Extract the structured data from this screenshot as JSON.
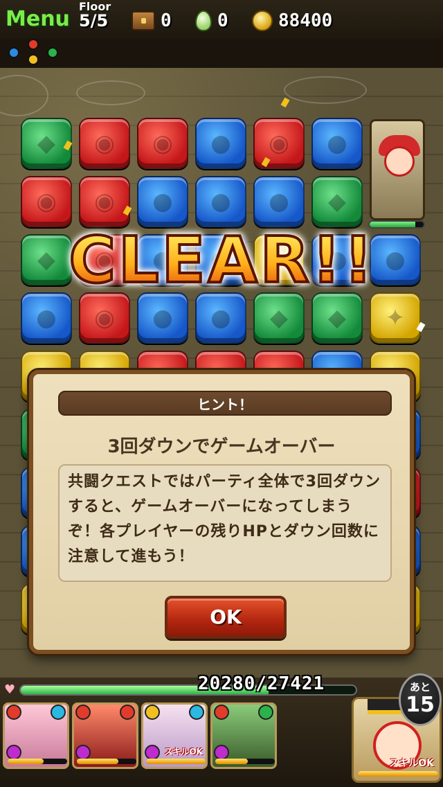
{
  "hud": {
    "menu_label": "Menu",
    "floor_label": "Floor",
    "floor_value": "5/5",
    "chest_count": "0",
    "egg_count": "0",
    "coins": "88400"
  },
  "board": {
    "orb_types": {
      "fire": "#c4171a",
      "water": "#1657c9",
      "wood": "#128a3a",
      "light": "#d4a500"
    },
    "enemy_hp_fraction": 0.85
  },
  "clear_banner": "CLEAR!!",
  "dialog": {
    "header": "ヒント！",
    "title": "3回ダウンでゲームオーバー",
    "body": "共闘クエストではパーティ全体で3回ダウンすると、ゲームオーバーになってしまうぞ！各プレイヤーの残りHPとダウン回数に注意して進もう！",
    "ok_label": "OK"
  },
  "team": {
    "hp_text": "20280/27421",
    "hp_fraction": 0.74,
    "turns_label": "あと",
    "turns_value": "15",
    "members": [
      {
        "skill_label": ""
      },
      {
        "skill_label": ""
      },
      {
        "skill_label": "スキルOK"
      },
      {
        "skill_label": ""
      }
    ],
    "leader_skill_label": "スキルOK"
  },
  "colors": {
    "accent_green": "#7dea4a",
    "dialog_bg": "#efe0bd",
    "ok_button": "#b2250f"
  }
}
